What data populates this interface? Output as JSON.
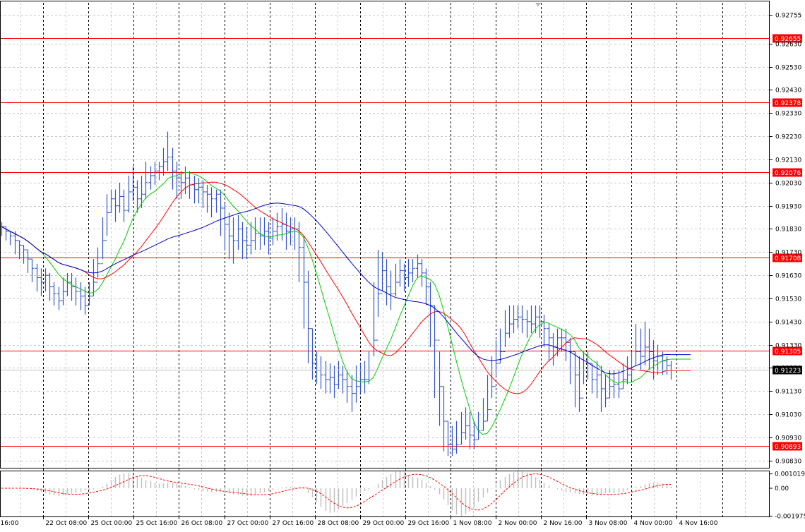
{
  "chart_data": {
    "type": "line",
    "subtype": "ohlc-bars-with-indicators",
    "price_axis": {
      "ylim": [
        0.90796,
        0.92806
      ],
      "ticks": [
        "0.92755",
        "0.92630",
        "0.92530",
        "0.92430",
        "0.92330",
        "0.92230",
        "0.92130",
        "0.92030",
        "0.91930",
        "0.91830",
        "0.91730",
        "0.91630",
        "0.91530",
        "0.91430",
        "0.91330",
        "0.91230",
        "0.91130",
        "0.91030",
        "0.90930",
        "0.90830"
      ],
      "current_price": "0.91223"
    },
    "time_axis": {
      "labels": [
        "16:00",
        "22 Oct 08:00",
        "25 Oct 00:00",
        "25 Oct 16:00",
        "26 Oct 08:00",
        "27 Oct 00:00",
        "27 Oct 16:00",
        "28 Oct 08:00",
        "29 Oct 00:00",
        "29 Oct 16:00",
        "1 Nov 08:00",
        "2 Nov 00:00",
        "2 Nov 16:00",
        "3 Nov 08:00",
        "4 Nov 00:00",
        "4 Nov 16:00"
      ]
    },
    "levels": [
      {
        "value": "0.92655",
        "color": "#ff0000"
      },
      {
        "value": "0.92378",
        "color": "#ff0000"
      },
      {
        "value": "0.92076",
        "color": "#ff0000"
      },
      {
        "value": "0.91708",
        "color": "#ff0000"
      },
      {
        "value": "0.91305",
        "color": "#ff0000"
      },
      {
        "value": "0.90893",
        "color": "#ff0000"
      }
    ],
    "series": [
      {
        "kind": "bars",
        "color": "#3355cc",
        "close": [
          0.9184,
          0.9182,
          0.918,
          0.9178,
          0.9176,
          0.9174,
          0.917,
          0.9166,
          0.9162,
          0.916,
          0.9163,
          0.9158,
          0.9155,
          0.9152,
          0.9156,
          0.916,
          0.9158,
          0.9156,
          0.9154,
          0.915,
          0.9154,
          0.916,
          0.9168,
          0.9178,
          0.919,
          0.9196,
          0.9193,
          0.9197,
          0.9191,
          0.9199,
          0.9201,
          0.9196,
          0.9198,
          0.9203,
          0.9206,
          0.9208,
          0.921,
          0.9212,
          0.9214,
          0.9208,
          0.9205,
          0.9203,
          0.9205,
          0.9202,
          0.92,
          0.9201,
          0.9199,
          0.9198,
          0.9196,
          0.9198,
          0.9192,
          0.9185,
          0.918,
          0.9178,
          0.9183,
          0.9178,
          0.9176,
          0.9178,
          0.9181,
          0.918,
          0.9182,
          0.9179,
          0.9182,
          0.9184,
          0.9185,
          0.9182,
          0.9183,
          0.9183,
          0.9175,
          0.916,
          0.914,
          0.9125,
          0.9122,
          0.912,
          0.9118,
          0.9119,
          0.9116,
          0.912,
          0.9118,
          0.9115,
          0.9112,
          0.9115,
          0.9118,
          0.9118,
          0.9122,
          0.9135,
          0.9155,
          0.9165,
          0.9158,
          0.9155,
          0.916,
          0.9165,
          0.9162,
          0.9164,
          0.9166,
          0.9168,
          0.9164,
          0.9158,
          0.915,
          0.9135,
          0.9115,
          0.91,
          0.909,
          0.9088,
          0.909,
          0.9095,
          0.9098,
          0.9094,
          0.9092,
          0.9096,
          0.91,
          0.9105,
          0.9115,
          0.9125,
          0.913,
          0.9138,
          0.9142,
          0.9144,
          0.9145,
          0.9144,
          0.9143,
          0.9142,
          0.9145,
          0.9143,
          0.914,
          0.9136,
          0.9132,
          0.9136,
          0.9136,
          0.9134,
          0.913,
          0.912,
          0.911,
          0.9122,
          0.9125,
          0.9118,
          0.912,
          0.9114,
          0.911,
          0.9115,
          0.9116,
          0.9114,
          0.9118,
          0.912,
          0.9122,
          0.913,
          0.9128,
          0.9132,
          0.913,
          0.9126,
          0.9128,
          0.9126,
          0.9124,
          0.9122
        ],
        "high": [
          0.9186,
          0.9184,
          0.9182,
          0.9182,
          0.9178,
          0.9176,
          0.9174,
          0.917,
          0.9168,
          0.9166,
          0.9166,
          0.9164,
          0.916,
          0.9158,
          0.9162,
          0.9164,
          0.9164,
          0.9162,
          0.916,
          0.9158,
          0.916,
          0.917,
          0.9175,
          0.9188,
          0.9198,
          0.92,
          0.92,
          0.9203,
          0.92,
          0.9206,
          0.921,
          0.9204,
          0.9206,
          0.9212,
          0.921,
          0.9212,
          0.9212,
          0.9218,
          0.9225,
          0.9218,
          0.9212,
          0.9208,
          0.921,
          0.9208,
          0.9206,
          0.9205,
          0.9204,
          0.9202,
          0.9201,
          0.92,
          0.92,
          0.9194,
          0.919,
          0.9188,
          0.9189,
          0.9186,
          0.9184,
          0.9186,
          0.9188,
          0.9188,
          0.9188,
          0.9186,
          0.9188,
          0.919,
          0.9192,
          0.919,
          0.9188,
          0.9188,
          0.9186,
          0.918,
          0.9165,
          0.914,
          0.913,
          0.9128,
          0.9126,
          0.9125,
          0.9124,
          0.9126,
          0.9124,
          0.9122,
          0.912,
          0.9124,
          0.9125,
          0.9126,
          0.913,
          0.916,
          0.9174,
          0.9173,
          0.917,
          0.9165,
          0.9168,
          0.917,
          0.9168,
          0.917,
          0.917,
          0.9172,
          0.917,
          0.9166,
          0.916,
          0.915,
          0.913,
          0.9115,
          0.91,
          0.9098,
          0.91,
          0.9104,
          0.9106,
          0.9104,
          0.91,
          0.9104,
          0.911,
          0.912,
          0.9128,
          0.9135,
          0.914,
          0.9148,
          0.915,
          0.915,
          0.915,
          0.915,
          0.9148,
          0.915,
          0.915,
          0.915,
          0.9146,
          0.9142,
          0.9138,
          0.914,
          0.914,
          0.914,
          0.9136,
          0.913,
          0.9128,
          0.913,
          0.913,
          0.9125,
          0.9126,
          0.9124,
          0.912,
          0.9122,
          0.9122,
          0.9122,
          0.9125,
          0.9128,
          0.913,
          0.9142,
          0.914,
          0.9143,
          0.914,
          0.9135,
          0.9133,
          0.913,
          0.9128,
          0.9126
        ],
        "low": [
          0.918,
          0.9178,
          0.9176,
          0.9172,
          0.917,
          0.9168,
          0.9164,
          0.916,
          0.9156,
          0.9154,
          0.9156,
          0.9152,
          0.915,
          0.9148,
          0.915,
          0.9154,
          0.9152,
          0.915,
          0.9148,
          0.9146,
          0.915,
          0.9154,
          0.9162,
          0.917,
          0.918,
          0.919,
          0.9186,
          0.919,
          0.9186,
          0.919,
          0.9195,
          0.919,
          0.9192,
          0.9196,
          0.92,
          0.9202,
          0.9204,
          0.9206,
          0.9208,
          0.92,
          0.9196,
          0.9196,
          0.9198,
          0.9196,
          0.9194,
          0.9194,
          0.9192,
          0.919,
          0.9188,
          0.919,
          0.918,
          0.9174,
          0.917,
          0.9168,
          0.9174,
          0.917,
          0.917,
          0.9172,
          0.9174,
          0.9174,
          0.9176,
          0.9172,
          0.9176,
          0.9178,
          0.9178,
          0.9174,
          0.9176,
          0.9174,
          0.916,
          0.914,
          0.9125,
          0.9118,
          0.9116,
          0.9114,
          0.9112,
          0.9112,
          0.911,
          0.9114,
          0.9112,
          0.9108,
          0.9104,
          0.9108,
          0.9112,
          0.9112,
          0.9116,
          0.9128,
          0.9145,
          0.9156,
          0.915,
          0.9148,
          0.9154,
          0.9158,
          0.9156,
          0.9158,
          0.916,
          0.9162,
          0.9158,
          0.915,
          0.9132,
          0.911,
          0.9098,
          0.9087,
          0.9085,
          0.9085,
          0.9086,
          0.909,
          0.9092,
          0.9088,
          0.9088,
          0.9092,
          0.9096,
          0.91,
          0.911,
          0.912,
          0.9125,
          0.9132,
          0.9136,
          0.9138,
          0.914,
          0.9138,
          0.9136,
          0.9138,
          0.9138,
          0.9136,
          0.9132,
          0.9126,
          0.9124,
          0.9128,
          0.913,
          0.9126,
          0.9116,
          0.9106,
          0.9104,
          0.9116,
          0.9118,
          0.9112,
          0.911,
          0.9104,
          0.9106,
          0.911,
          0.911,
          0.911,
          0.9114,
          0.9116,
          0.9118,
          0.9124,
          0.9122,
          0.9124,
          0.9122,
          0.9118,
          0.912,
          0.912,
          0.912,
          0.9118
        ]
      },
      {
        "kind": "ma",
        "period": 5,
        "color": "#00cc00"
      },
      {
        "kind": "ma",
        "period": 10,
        "color": "#ff0000"
      },
      {
        "kind": "ma",
        "period": 20,
        "color": "#0000cc"
      }
    ],
    "oscillator": {
      "ylim": [
        -0.002,
        0.0012
      ],
      "ticks": [
        "0.001019",
        "0.00",
        "-0.001975"
      ],
      "histogram_color": "#c0c0c0",
      "signal_color": "#ff0000"
    },
    "grid": true,
    "period_separators": true
  }
}
